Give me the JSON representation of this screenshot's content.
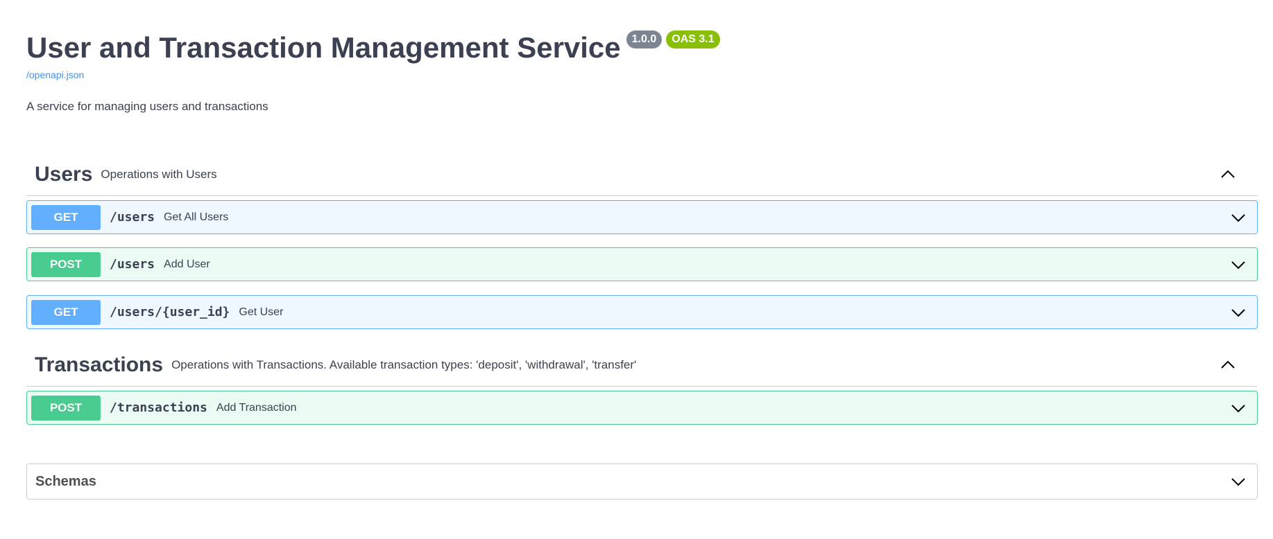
{
  "info": {
    "title": "User and Transaction Management Service",
    "version_badge": "1.0.0",
    "oas_badge": "OAS 3.1",
    "spec_link": "/openapi.json",
    "description": "A service for managing users and transactions"
  },
  "tags": [
    {
      "name": "Users",
      "description": "Operations with Users",
      "expanded": true,
      "operations": [
        {
          "method": "GET",
          "path": "/users",
          "summary": "Get All Users"
        },
        {
          "method": "POST",
          "path": "/users",
          "summary": "Add User"
        },
        {
          "method": "GET",
          "path": "/users/{user_id}",
          "summary": "Get User"
        }
      ]
    },
    {
      "name": "Transactions",
      "description": "Operations with Transactions. Available transaction types: 'deposit', 'withdrawal', 'transfer'",
      "expanded": true,
      "operations": [
        {
          "method": "POST",
          "path": "/transactions",
          "summary": "Add Transaction"
        }
      ]
    }
  ],
  "schemas": {
    "title": "Schemas",
    "expanded": false
  },
  "colors": {
    "get": "#61affe",
    "post": "#49cc90",
    "version_badge": "#7d8492",
    "oas_badge": "#89bf04",
    "link": "#4990e2"
  },
  "icons": {
    "expanded": "chevron-up-icon",
    "collapsed": "chevron-down-icon"
  }
}
